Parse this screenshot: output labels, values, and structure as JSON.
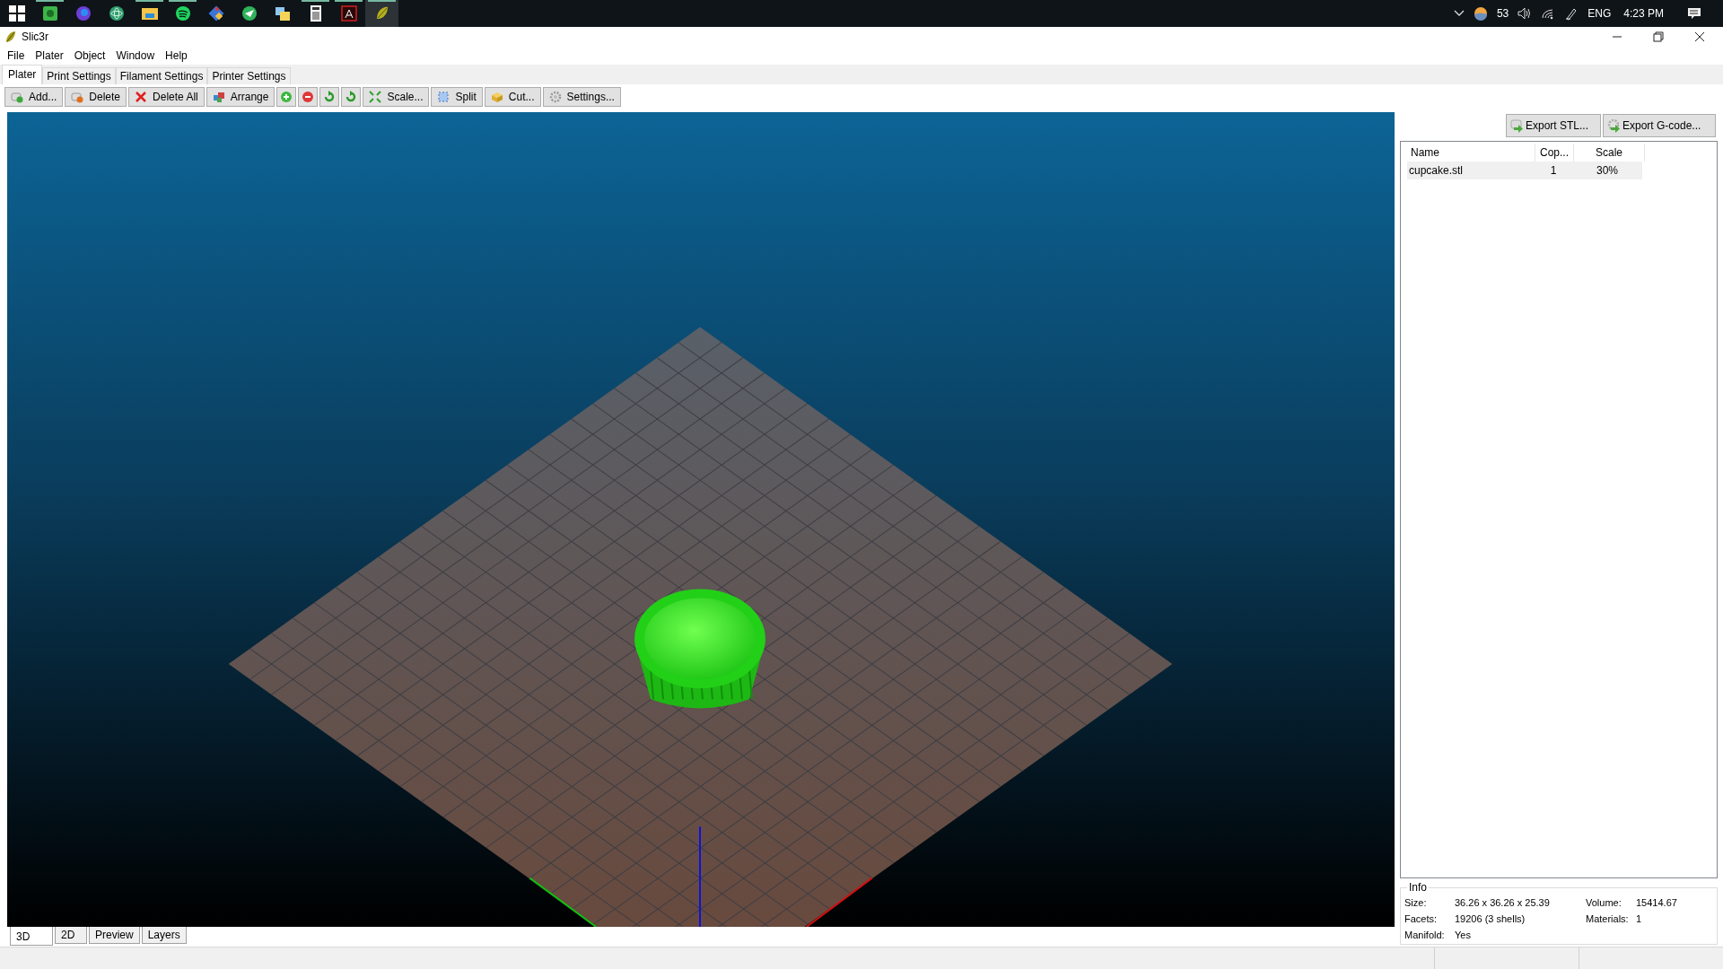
{
  "taskbar": {
    "apps": [
      {
        "kind": "start",
        "running": false,
        "selected": false
      },
      {
        "kind": "notes",
        "running": true,
        "selected": false
      },
      {
        "kind": "browser",
        "running": false,
        "selected": false
      },
      {
        "kind": "atom",
        "running": false,
        "selected": false
      },
      {
        "kind": "folder",
        "running": true,
        "selected": false
      },
      {
        "kind": "music",
        "running": true,
        "selected": false
      },
      {
        "kind": "git",
        "running": false,
        "selected": false
      },
      {
        "kind": "send",
        "running": false,
        "selected": false
      },
      {
        "kind": "files",
        "running": false,
        "selected": false
      },
      {
        "kind": "calculator",
        "running": true,
        "selected": false
      },
      {
        "kind": "pdf",
        "running": true,
        "selected": false
      },
      {
        "kind": "slicer",
        "running": true,
        "selected": true
      }
    ],
    "tray": {
      "temperature": "53",
      "language": "ENG",
      "time": "4:23 PM"
    }
  },
  "window": {
    "title": "Slic3r"
  },
  "menu": [
    "File",
    "Plater",
    "Object",
    "Window",
    "Help"
  ],
  "tabs": [
    {
      "label": "Plater",
      "selected": true
    },
    {
      "label": "Print Settings",
      "selected": false
    },
    {
      "label": "Filament Settings",
      "selected": false
    },
    {
      "label": "Printer Settings",
      "selected": false
    }
  ],
  "toolbar": [
    {
      "kind": "add",
      "label": "Add..."
    },
    {
      "kind": "delete",
      "label": "Delete"
    },
    {
      "kind": "delete-all",
      "label": "Delete All"
    },
    {
      "kind": "arrange",
      "label": "Arrange"
    },
    {
      "kind": "increase"
    },
    {
      "kind": "decrease"
    },
    {
      "kind": "rotate-left"
    },
    {
      "kind": "rotate-right"
    },
    {
      "kind": "scale",
      "label": "Scale..."
    },
    {
      "kind": "split",
      "label": "Split"
    },
    {
      "kind": "cut",
      "label": "Cut..."
    },
    {
      "kind": "settings",
      "label": "Settings..."
    }
  ],
  "export_buttons": [
    {
      "kind": "stl",
      "label": "Export STL..."
    },
    {
      "kind": "gcode",
      "label": "Export G-code..."
    }
  ],
  "objects": {
    "columns": [
      "Name",
      "Cop...",
      "Scale"
    ],
    "rows": [
      {
        "name": "cupcake.stl",
        "copies": "1",
        "scale": "30%"
      }
    ]
  },
  "info": {
    "title": "Info",
    "fields": [
      {
        "label": "Size:",
        "value": "36.26 x 36.26 x 25.39"
      },
      {
        "label": "Volume:",
        "value": "15414.67"
      },
      {
        "label": "Facets:",
        "value": "19206 (3 shells)"
      },
      {
        "label": "Materials:",
        "value": "1"
      },
      {
        "label": "Manifold:",
        "value": "Yes"
      }
    ]
  },
  "view_tabs": [
    {
      "label": "3D",
      "selected": true
    },
    {
      "label": "2D",
      "selected": false
    },
    {
      "label": "Preview",
      "selected": false
    },
    {
      "label": "Layers",
      "selected": false
    }
  ]
}
